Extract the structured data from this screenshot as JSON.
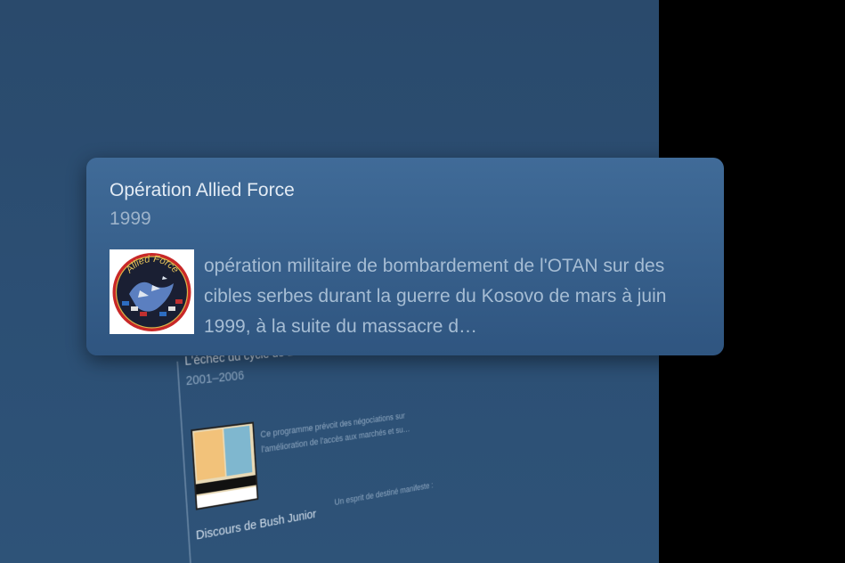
{
  "card": {
    "title": "Opération Allied Force",
    "year": "1999",
    "image_name": "allied-force-patch",
    "patch_text": "Allied Force",
    "description": "opération militaire de bombardement de l'OTAN sur des cibles serbes durant la guerre du Kosovo de mars à juin 1999, à la suite du massacre d…"
  },
  "timeline": [
    {
      "title": "L'échec du cycle de Doha",
      "year": "2001–2006",
      "description": "Ce programme prévoit des négociations sur l'amélioration de l'accès aux marchés et su…"
    },
    {
      "title": "Discours de Bush Junior",
      "description": "Un esprit de destiné manifeste :"
    }
  ],
  "colors": {
    "background": "#2c4f74",
    "card": "#3a638f",
    "title_text": "#e3ebf4",
    "secondary_text": "#a6bdd4",
    "side": "#000000"
  }
}
